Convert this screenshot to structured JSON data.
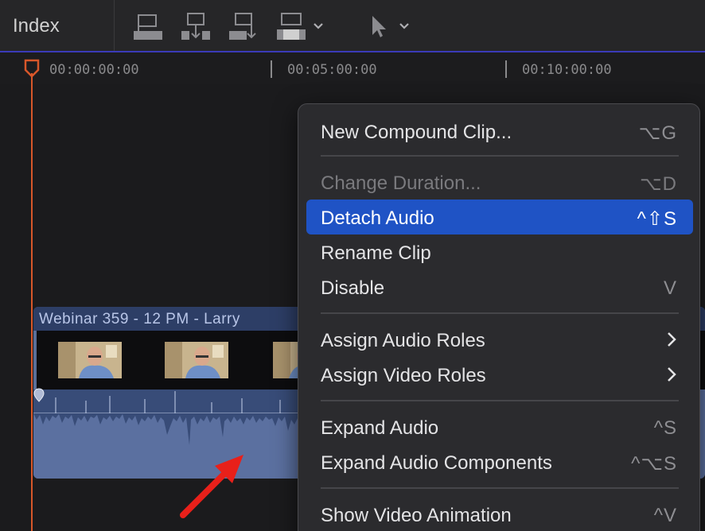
{
  "toolbar": {
    "index_label": "Index",
    "icons": [
      "connect-clip-icon",
      "insert-clip-icon",
      "append-clip-icon",
      "overwrite-clip-icon",
      "select-tool-icon"
    ]
  },
  "ruler": {
    "timecodes": [
      "00:00:00:00",
      "00:05:00:00",
      "00:10:00:00"
    ]
  },
  "clip": {
    "title": "Webinar 359 - 12 PM - Larry"
  },
  "menu": {
    "items": [
      {
        "label": "New Compound Clip...",
        "shortcut": "⌥G",
        "state": "normal"
      },
      {
        "label": "Change Duration...",
        "shortcut": "⌥D",
        "state": "disabled"
      },
      {
        "label": "Detach Audio",
        "shortcut": "^⇧S",
        "state": "highlight"
      },
      {
        "label": "Rename Clip",
        "shortcut": "",
        "state": "normal"
      },
      {
        "label": "Disable",
        "shortcut": "V",
        "state": "normal"
      },
      {
        "label": "Assign Audio Roles",
        "shortcut": "",
        "state": "submenu"
      },
      {
        "label": "Assign Video Roles",
        "shortcut": "",
        "state": "submenu"
      },
      {
        "label": "Expand Audio",
        "shortcut": "^S",
        "state": "normal"
      },
      {
        "label": "Expand Audio Components",
        "shortcut": "^⌥S",
        "state": "normal"
      },
      {
        "label": "Show Video Animation",
        "shortcut": "^V",
        "state": "normal"
      }
    ]
  },
  "colors": {
    "highlight": "#1f53c5",
    "playhead": "#d8572a",
    "annotation_arrow": "#e8201a"
  }
}
